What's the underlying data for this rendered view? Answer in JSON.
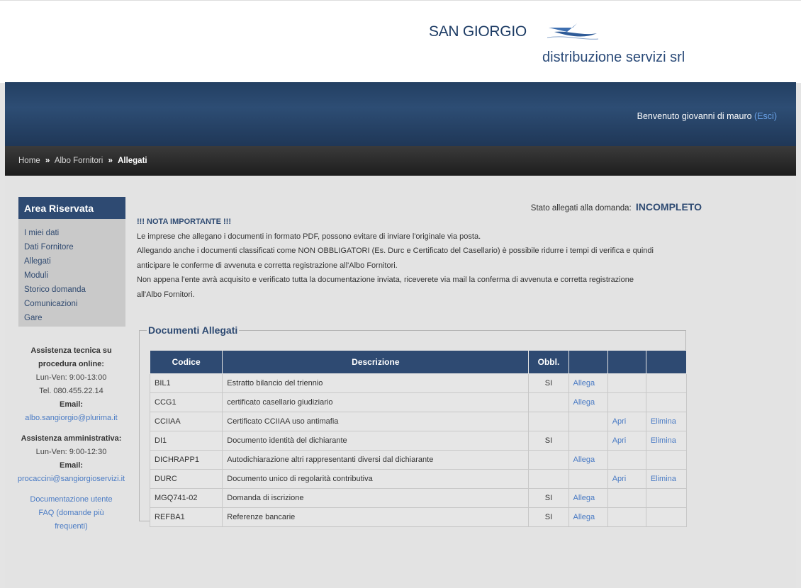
{
  "logo": {
    "line1": "SAN GIORGIO",
    "line2": "distribuzione servizi srl"
  },
  "header": {
    "welcome": "Benvenuto giovanni di mauro",
    "logout": "(Esci)"
  },
  "breadcrumb": {
    "home": "Home",
    "section": "Albo Fornitori",
    "current": "Allegati",
    "separator": "»"
  },
  "sidebar": {
    "title": "Area Riservata",
    "items": [
      "I miei dati",
      "Dati Fornitore",
      "Allegati",
      "Moduli",
      "Storico domanda",
      "Comunicazioni",
      "Gare"
    ]
  },
  "assistance": {
    "tech_title_1": "Assistenza tecnica su",
    "tech_title_2": "procedura online:",
    "tech_hours": "Lun-Ven: 9:00-13:00",
    "tech_phone": "Tel. 080.455.22.14",
    "tech_email_label": "Email:",
    "tech_email": "albo.sangiorgio@plurima.it",
    "admin_title": "Assistenza amministrativa:",
    "admin_hours": "Lun-Ven: 9:00-12:30",
    "admin_email_label": "Email:",
    "admin_email": "procaccini@sangiorgioservizi.it",
    "doc_link": "Documentazione utente",
    "faq_link_1": "FAQ (domande più",
    "faq_link_2": "frequenti)"
  },
  "status": {
    "label": "Stato allegati alla domanda:",
    "value": "INCOMPLETO"
  },
  "notice": {
    "title": "!!! NOTA IMPORTANTE !!!",
    "line1": "Le imprese che allegano i documenti in formato PDF, possono evitare di inviare l'originale via posta.",
    "line2": "Allegando anche i documenti classificati come NON OBBLIGATORI (Es. Durc e Certificato del Casellario) è possibile ridurre i tempi di verifica e quindi",
    "line3": "anticipare le conferme di avvenuta e corretta registrazione all'Albo Fornitori.",
    "line4": "Non appena l'ente avrà acquisito e verificato tutta la documentazione inviata, riceverete via mail la conferma di avvenuta e corretta registrazione",
    "line5": "all'Albo Fornitori."
  },
  "documents": {
    "legend": "Documenti Allegati",
    "headers": {
      "code": "Codice",
      "description": "Descrizione",
      "required": "Obbl."
    },
    "rows": [
      {
        "code": "BIL1",
        "description": "Estratto bilancio del triennio",
        "required": "SI",
        "allega": "Allega",
        "apri": "",
        "elimina": ""
      },
      {
        "code": "CCG1",
        "description": "certificato casellario giudiziario",
        "required": "",
        "allega": "Allega",
        "apri": "",
        "elimina": ""
      },
      {
        "code": "CCIIAA",
        "description": "Certificato CCIIAA uso antimafia",
        "required": "",
        "allega": "",
        "apri": "Apri",
        "elimina": "Elimina"
      },
      {
        "code": "DI1",
        "description": "Documento identità del dichiarante",
        "required": "SI",
        "allega": "",
        "apri": "Apri",
        "elimina": "Elimina"
      },
      {
        "code": "DICHRAPP1",
        "description": "Autodichiarazione altri rappresentanti diversi dal dichiarante",
        "required": "",
        "allega": "Allega",
        "apri": "",
        "elimina": ""
      },
      {
        "code": "DURC",
        "description": "Documento unico di regolarità contributiva",
        "required": "",
        "allega": "",
        "apri": "Apri",
        "elimina": "Elimina"
      },
      {
        "code": "MGQ741-02",
        "description": "Domanda di iscrizione",
        "required": "SI",
        "allega": "Allega",
        "apri": "",
        "elimina": ""
      },
      {
        "code": "REFBA1",
        "description": "Referenze bancarie",
        "required": "SI",
        "allega": "Allega",
        "apri": "",
        "elimina": ""
      }
    ]
  },
  "colors": {
    "navy": "#2e4a72",
    "link": "#4a7bc4",
    "background": "#e4e4e4"
  }
}
